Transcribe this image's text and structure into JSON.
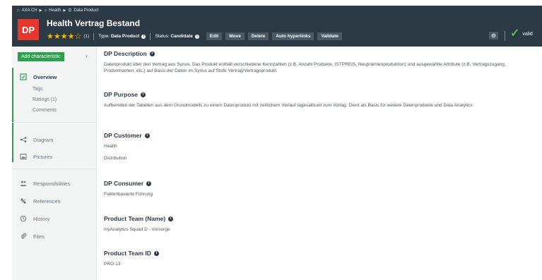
{
  "breadcrumb": {
    "items": [
      "AXA CH",
      "Health",
      "Data Product"
    ]
  },
  "header": {
    "badge": "DP",
    "title": "Health Vertrag Bestand",
    "stars": "★★★★☆",
    "rating_count": "(1)",
    "type_label": "Type:",
    "type_value": "Data Product",
    "status_label": "Status:",
    "status_value": "Candidate",
    "buttons": {
      "edit": "Edit",
      "move": "Move",
      "delete": "Delete",
      "auto_hyperlinks": "Auto hyperlinks",
      "validate": "Validate"
    },
    "valid_label": "valid",
    "colors": {
      "header_bg": "#2b3a44",
      "badge_bg": "#e6372f",
      "star": "#f5b800",
      "valid_check": "#5cb85c"
    }
  },
  "sidebar": {
    "add_button": "Add characteristic",
    "collapse_icon": "chevron-left-icon",
    "overview": "Overview",
    "sub_items": [
      "Tags",
      "Ratings (1)",
      "Comments"
    ],
    "items": [
      {
        "label": "Diagram",
        "icon": "diagram-icon"
      },
      {
        "label": "Pictures",
        "icon": "picture-icon"
      },
      {
        "label": "Responsibilities",
        "icon": "people-icon"
      },
      {
        "label": "References",
        "icon": "references-icon"
      },
      {
        "label": "History",
        "icon": "history-icon"
      },
      {
        "label": "Files",
        "icon": "paperclip-icon"
      }
    ],
    "colors": {
      "accent": "#2e9e4f"
    }
  },
  "main": {
    "fields": [
      {
        "label": "DP Description",
        "values": [
          "Datenprodukt über den Vertrag aus Syrius. Das Produkt enthält verschiedene Kennzahlen (z.B. Anzahl Produkte, ISTPREIS, Neuprämienproduktion) und ausgewählte Attribute (z.B. Vertragszugang, Produktnamen, etc.) auf Basis der Daten im Syrius auf Stufe Vertrag/Vertragsprodukt"
        ]
      },
      {
        "label": "DP Purpose",
        "values": [
          "Aufbereiten der Tabellen aus dem Grundmodells zu einem Datenprodukt mit zeitlichem Verlauf tagesaktuell zum Vortag. Dient als Basis für weitere Datenprodukte und Data Analytics"
        ]
      },
      {
        "label": "DP Customer",
        "values": [
          "Health",
          "Distribution"
        ]
      },
      {
        "label": "DP Consumer",
        "values": [
          "Faktenbasierte Führung"
        ]
      },
      {
        "label": "Product Team (Name)",
        "values": [
          "myAnalytics Squad D - Vorsorge"
        ]
      },
      {
        "label": "Product Team ID",
        "values": [
          "PRO-13"
        ]
      }
    ]
  }
}
